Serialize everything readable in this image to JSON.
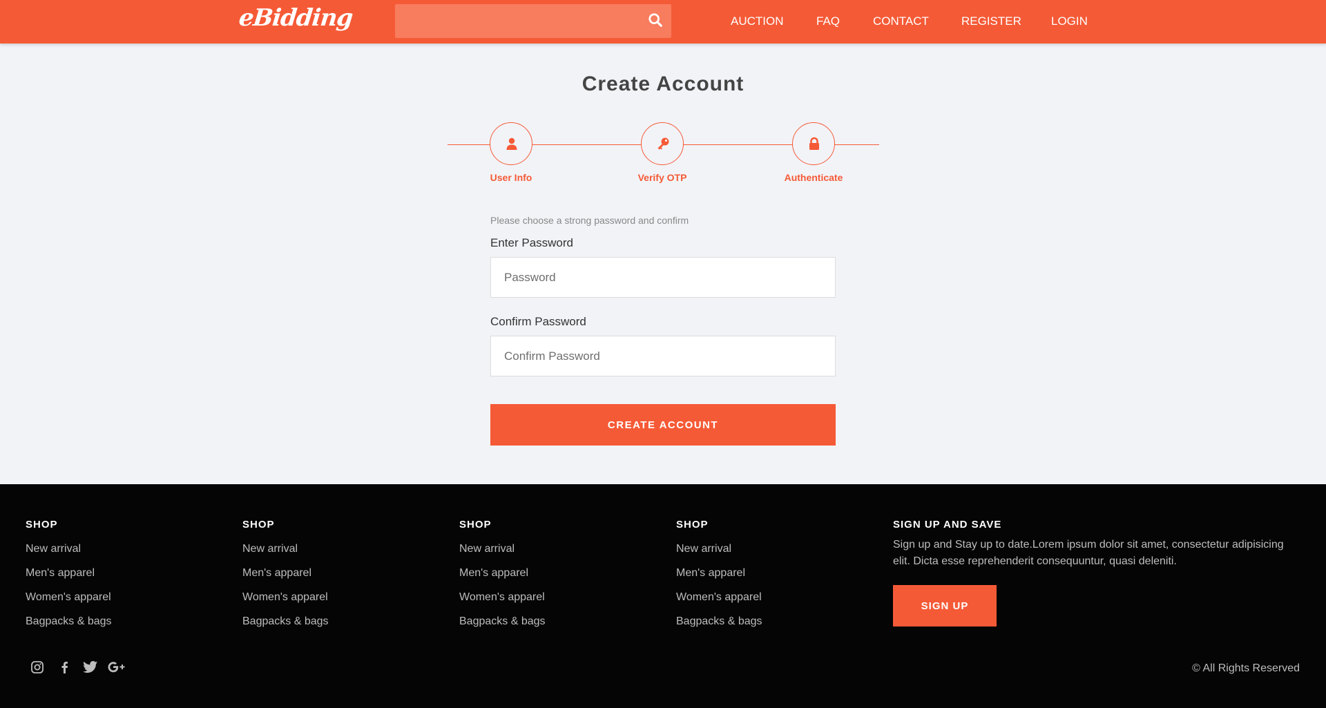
{
  "header": {
    "logo": "eBidding",
    "search": {
      "value": "",
      "placeholder": ""
    },
    "nav": [
      "AUCTION",
      "FAQ",
      "CONTACT",
      "REGISTER",
      "LOGIN"
    ]
  },
  "main": {
    "title": "Create Account",
    "steps": [
      {
        "label": "User Info",
        "icon": "user-icon"
      },
      {
        "label": "Verify OTP",
        "icon": "key-icon"
      },
      {
        "label": "Authenticate",
        "icon": "lock-icon"
      }
    ],
    "hint": "Please choose a strong password and confirm",
    "password": {
      "label": "Enter Password",
      "placeholder": "Password",
      "value": ""
    },
    "confirm": {
      "label": "Confirm Password",
      "placeholder": "Confirm Password",
      "value": ""
    },
    "submit_label": "CREATE ACCOUNT"
  },
  "footer": {
    "columns": [
      {
        "heading": "SHOP",
        "links": [
          "New arrival",
          "Men's apparel",
          "Women's apparel",
          "Bagpacks & bags"
        ]
      },
      {
        "heading": "SHOP",
        "links": [
          "New arrival",
          "Men's apparel",
          "Women's apparel",
          "Bagpacks & bags"
        ]
      },
      {
        "heading": "SHOP",
        "links": [
          "New arrival",
          "Men's apparel",
          "Women's apparel",
          "Bagpacks & bags"
        ]
      },
      {
        "heading": "SHOP",
        "links": [
          "New arrival",
          "Men's apparel",
          "Women's apparel",
          "Bagpacks & bags"
        ]
      }
    ],
    "signup": {
      "heading": "SIGN UP AND SAVE",
      "text": "Sign up and Stay up to date.Lorem ipsum dolor sit amet, consectetur adipisicing elit. Dicta esse reprehenderit consequuntur, quasi deleniti.",
      "button_label": "SIGN UP"
    },
    "social_icons": [
      "instagram-icon",
      "facebook-icon",
      "twitter-icon",
      "google-plus-icon"
    ],
    "copyright": "© All Rights Reserved"
  },
  "colors": {
    "accent": "#f55a36",
    "background": "#f2f3f7",
    "footer": "#050505"
  }
}
